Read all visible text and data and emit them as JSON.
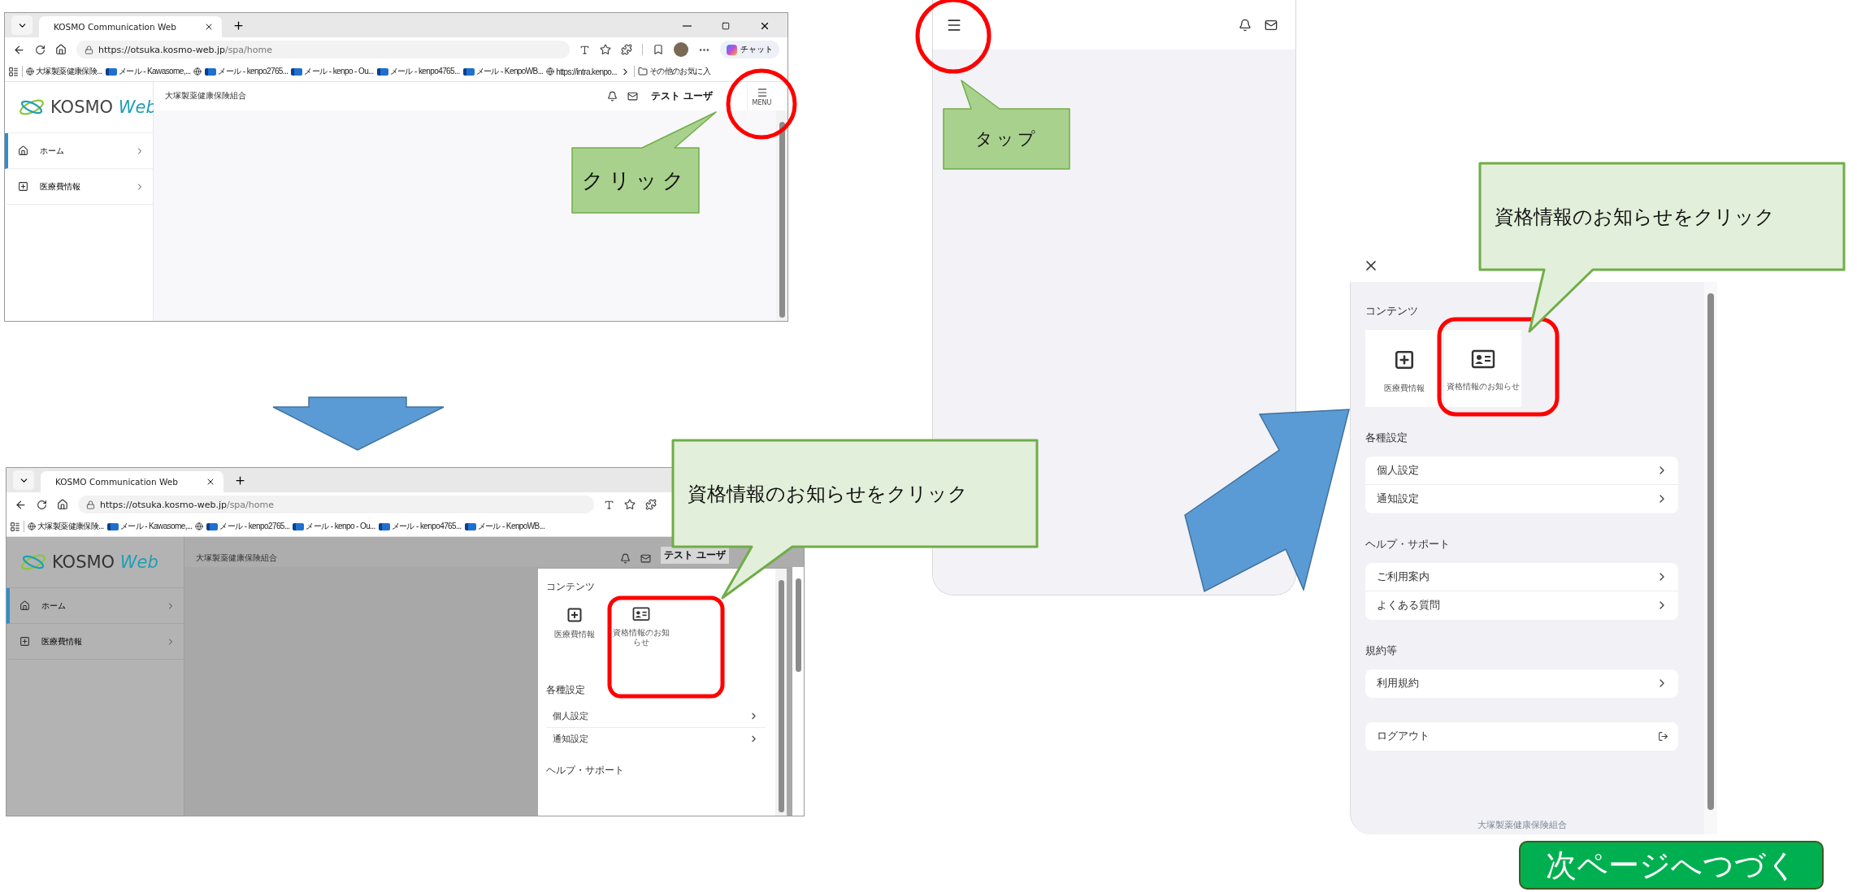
{
  "step1": {
    "browser": {
      "tabs": [
        {
          "label": "KOSMO Communication Web",
          "selected": true
        }
      ],
      "address": {
        "host": "https://otsuka.kosmo-web.jp",
        "path": "/spa/home"
      },
      "chat_button": "チャット",
      "bookmarks": [
        {
          "kind": "web",
          "label": "大塚製薬健康保険..."
        },
        {
          "kind": "mail",
          "label": "メール - Kawasome,..."
        },
        {
          "kind": "web"
        },
        {
          "kind": "mail",
          "label": "メール - kenpo2765..."
        },
        {
          "kind": "mail",
          "label": "メール - kenpo - Ou..."
        },
        {
          "kind": "mail",
          "label": "メール - kenpo4765..."
        },
        {
          "kind": "mail",
          "label": "メール - KenpoWB..."
        },
        {
          "kind": "web",
          "label": "https://intra.kenpo..."
        }
      ],
      "other_bookmarks": "その他のお気に入"
    },
    "site": {
      "logo": {
        "name": "KOSMO",
        "accent": "Web"
      },
      "org": "大塚製薬健康保険組合",
      "user": "テスト ユーザ",
      "menu_button": "MENU",
      "nav": [
        {
          "label": "ホーム",
          "selected": true
        },
        {
          "label": "医療費情報",
          "selected": false
        }
      ]
    },
    "callout": "クリック"
  },
  "step2": {
    "browser": {
      "tabs": [
        {
          "label": "KOSMO Communication Web",
          "selected": true
        }
      ],
      "address": {
        "host": "https://otsuka.kosmo-web.jp",
        "path": "/spa/home"
      },
      "bookmarks": [
        {
          "kind": "web",
          "label": "大塚製薬健康保険..."
        },
        {
          "kind": "mail",
          "label": "メール - Kawasome,..."
        },
        {
          "kind": "web"
        },
        {
          "kind": "mail",
          "label": "メール - kenpo2765..."
        },
        {
          "kind": "mail",
          "label": "メール - kenpo - Ou..."
        },
        {
          "kind": "mail",
          "label": "メール - kenpo4765..."
        },
        {
          "kind": "mail",
          "label": "メール - KenpoWB..."
        }
      ]
    },
    "site": {
      "logo": {
        "name": "KOSMO",
        "accent": "Web"
      },
      "org": "大塚製薬健康保険組合",
      "user": "テスト ユーザ",
      "nav": [
        {
          "label": "ホーム",
          "selected": true
        },
        {
          "label": "医療費情報",
          "selected": false
        }
      ]
    },
    "menu": {
      "sections": [
        {
          "title": "コンテンツ",
          "kind": "tiles",
          "items": [
            {
              "label": "医療費情報"
            },
            {
              "label": "資格情報のお知らせ"
            }
          ]
        },
        {
          "title": "各種設定",
          "kind": "rows",
          "items": [
            {
              "label": "個人設定",
              "kind": "link"
            },
            {
              "label": "通知設定",
              "kind": "link"
            }
          ]
        },
        {
          "title": "ヘルプ・サポート",
          "kind": "rows"
        }
      ]
    },
    "callout": "資格情報のお知らせをクリック"
  },
  "step3": {
    "callout": "タップ"
  },
  "step4": {
    "menu": {
      "sections": [
        {
          "title": "コンテンツ",
          "kind": "tiles",
          "items": [
            {
              "label": "医療費情報"
            },
            {
              "label": "資格情報のお知らせ"
            }
          ]
        },
        {
          "title": "各種設定",
          "kind": "rows",
          "items": [
            {
              "label": "個人設定",
              "kind": "link"
            },
            {
              "label": "通知設定",
              "kind": "link"
            }
          ]
        },
        {
          "title": "ヘルプ・サポート",
          "kind": "rows",
          "items": [
            {
              "label": "ご利用案内",
              "kind": "link"
            },
            {
              "label": "よくある質問",
              "kind": "link"
            }
          ]
        },
        {
          "title": "規約等",
          "kind": "rows",
          "items": [
            {
              "label": "利用規約",
              "kind": "link"
            }
          ]
        },
        {
          "kind": "rows",
          "items": [
            {
              "label": "ログアウト",
              "kind": "logout"
            }
          ]
        }
      ],
      "footer": "大塚製薬健康保険組合"
    },
    "callout": "資格情報のお知らせをクリック"
  },
  "next_button": "次ページへつづく"
}
